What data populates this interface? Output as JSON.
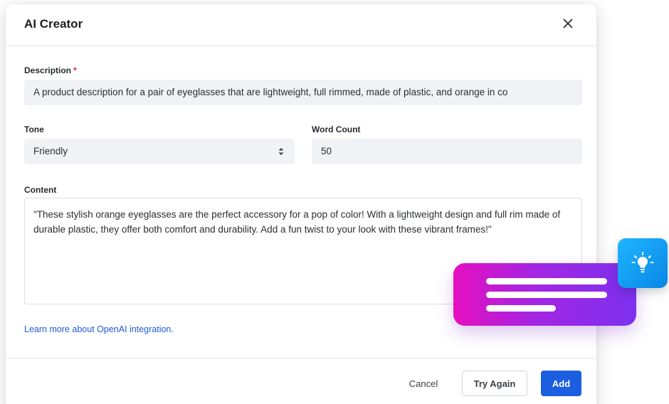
{
  "modal": {
    "title": "AI Creator",
    "close_icon": "close-icon"
  },
  "description": {
    "label": "Description",
    "required_mark": "*",
    "value": "A product description for a pair of eyeglasses that are lightweight, full rimmed, made of plastic, and orange in co"
  },
  "tone": {
    "label": "Tone",
    "selected": "Friendly",
    "arrow_icon": "select-arrows-icon"
  },
  "word_count": {
    "label": "Word Count",
    "value": "50"
  },
  "content": {
    "label": "Content",
    "text": "\"These stylish orange eyeglasses are the perfect accessory for a pop of color! With a lightweight design and full rim made of durable plastic, they offer both comfort and durability. Add a fun twist to your look with these vibrant frames!\""
  },
  "learn_link": "Learn more about OpenAI integration.",
  "buttons": {
    "cancel": "Cancel",
    "try_again": "Try Again",
    "add": "Add"
  },
  "colors": {
    "primary": "#1c5ee0",
    "link": "#1f5bd8",
    "required": "#d1293d",
    "card_gradient_start": "#e50fc0",
    "card_gradient_end": "#7c31ef",
    "badge": "#0a86e6"
  },
  "decor": {
    "card_icon": "text-lines-icon",
    "badge_icon": "lightbulb-icon"
  }
}
